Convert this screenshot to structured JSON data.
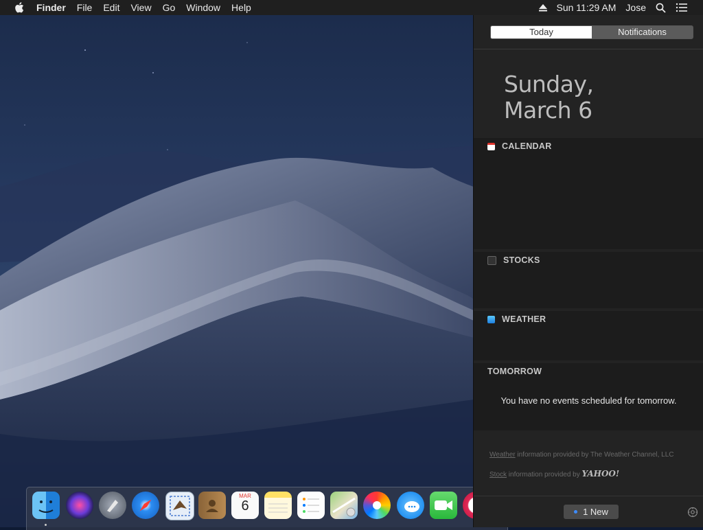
{
  "menubar": {
    "app_name": "Finder",
    "menus": [
      "File",
      "Edit",
      "View",
      "Go",
      "Window",
      "Help"
    ],
    "clock": "Sun 11:29 AM",
    "user": "Jose"
  },
  "notification_center": {
    "tabs": {
      "today": "Today",
      "notifications": "Notifications"
    },
    "active_tab": "Today",
    "date_line1": "Sunday,",
    "date_line2": "March 6",
    "calendar_header": "CALENDAR",
    "stocks_header": "STOCKS",
    "weather_header": "WEATHER",
    "tomorrow_header": "TOMORROW",
    "tomorrow_message": "You have no events scheduled for tomorrow.",
    "weather_credit_link": "Weather",
    "weather_credit_text": " information provided by The Weather Channel, LLC",
    "stock_credit_link": "Stock",
    "stock_credit_text": " information provided by ",
    "stock_credit_brand": "YAHOO!",
    "new_button": "1 New"
  },
  "dock": {
    "apps": [
      "finder-icon",
      "siri-icon",
      "launchpad-icon",
      "safari-icon",
      "mail-icon",
      "contacts-icon",
      "calendar-icon",
      "notes-icon",
      "reminders-icon",
      "maps-icon",
      "photos-icon",
      "messages-icon",
      "facetime-icon",
      "itunes-icon"
    ],
    "calendar_month": "MAR",
    "calendar_day": "6"
  },
  "colors": {
    "menubar_bg": "#1f1f1f",
    "panel_bg": "#232323",
    "accent_blue": "#3d8cff"
  }
}
